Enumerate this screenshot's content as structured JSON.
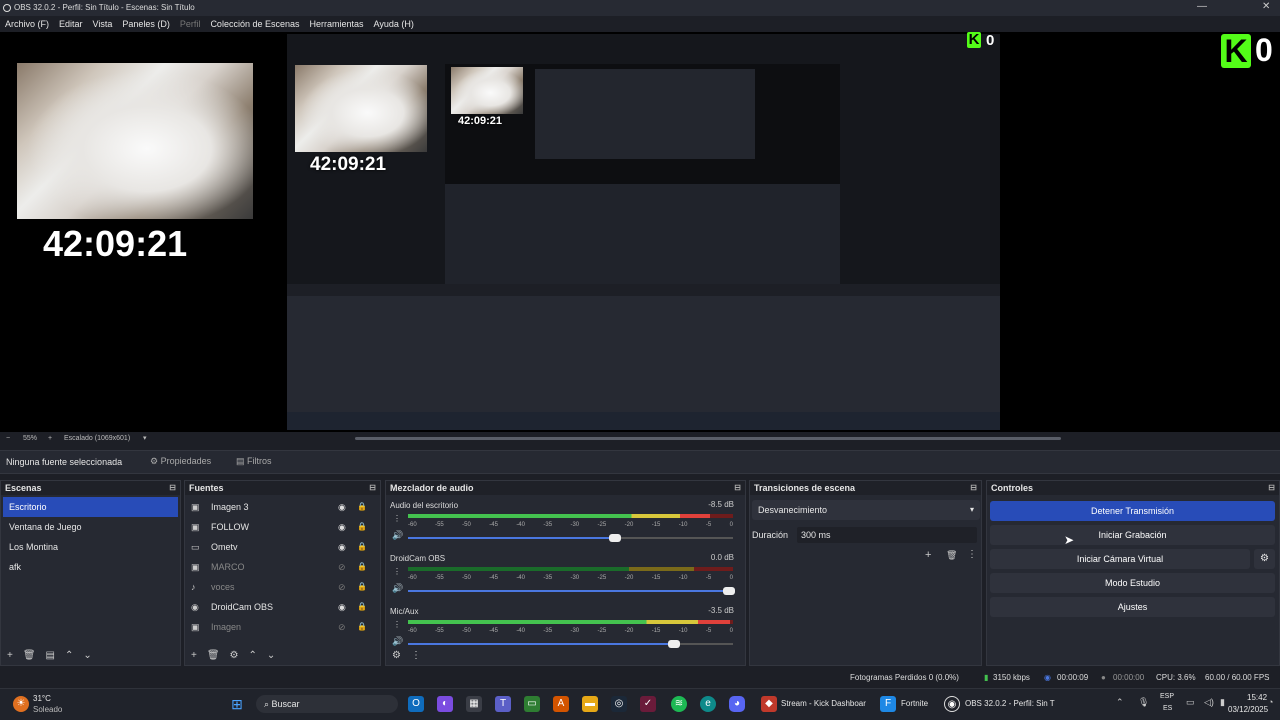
{
  "window": {
    "title": "OBS 32.0.2 - Perfil: Sin Título - Escenas: Sin Título",
    "min": "—",
    "close": "✕"
  },
  "menu": [
    "Archivo (F)",
    "Editar",
    "Vista",
    "Paneles (D)",
    "Perfil",
    "Colección de Escenas",
    "Herramientas",
    "Ayuda (H)"
  ],
  "preview": {
    "clock": "42:09:21",
    "kick_count": "0",
    "kick_logo": "K"
  },
  "zoom": {
    "minus": "−",
    "percent": "55%",
    "plus": "+",
    "scale": "Escalado (1069x601)"
  },
  "sourcebar": {
    "none": "Ninguna fuente seleccionada",
    "properties": "Propiedades",
    "filters": "Filtros"
  },
  "scenes": {
    "title": "Escenas",
    "items": [
      "Escritorio",
      "Ventana de Juego",
      "Los Montina",
      "afk"
    ]
  },
  "sources": {
    "title": "Fuentes",
    "items": [
      {
        "name": "Imagen 3",
        "icon": "image-icon",
        "visible": true,
        "locked": true
      },
      {
        "name": "FOLLOW",
        "icon": "image-icon",
        "visible": true,
        "locked": false
      },
      {
        "name": "Ometv",
        "icon": "window-icon",
        "visible": true,
        "locked": true
      },
      {
        "name": "MARCO",
        "icon": "image-icon",
        "visible": false,
        "locked": true
      },
      {
        "name": "voces",
        "icon": "audio-icon",
        "visible": false,
        "locked": true
      },
      {
        "name": "DroidCam OBS",
        "icon": "video-icon",
        "visible": true,
        "locked": true
      },
      {
        "name": "Imagen",
        "icon": "image-icon",
        "visible": false,
        "locked": true
      }
    ]
  },
  "mixer": {
    "title": "Mezclador de audio",
    "scale": [
      "-60",
      "-55",
      "-50",
      "-45",
      "-40",
      "-35",
      "-30",
      "-25",
      "-20",
      "-15",
      "-10",
      "-5",
      "0"
    ],
    "channels": [
      {
        "name": "Audio del escritorio",
        "db": "-8.5 dB",
        "level": 0.93,
        "volume": 0.65
      },
      {
        "name": "DroidCam OBS",
        "db": "0.0 dB",
        "level": 0.0,
        "volume": 1.0
      },
      {
        "name": "Mic/Aux",
        "db": "-3.5 dB",
        "level": 0.99,
        "volume": 0.83
      }
    ]
  },
  "transitions": {
    "title": "Transiciones de escena",
    "type": "Desvanecimiento",
    "duration_label": "Duración",
    "duration": "300 ms"
  },
  "controls": {
    "title": "Controles",
    "stop_stream": "Detener Transmisión",
    "start_rec": "Iniciar Grabación",
    "virtual_cam": "Iniciar Cámara Virtual",
    "studio": "Modo Estudio",
    "settings": "Ajustes"
  },
  "status": {
    "dropped": "Fotogramas Perdidos 0 (0.0%)",
    "kbps": "3150 kbps",
    "stream_time": "00:00:09",
    "rec_time": "00:00:00",
    "cpu": "CPU: 3.6%",
    "fps": "60.00 / 60.00 FPS"
  },
  "taskbar": {
    "temp": "31°C",
    "weather": "Soleado",
    "search": "Buscar",
    "kick_app": "Stream - Kick Dashboar",
    "fortnite": "Fortnite",
    "obs_app": "OBS 32.0.2 - Perfil: Sin T",
    "lang1": "ESP",
    "lang2": "ES",
    "time": "15:42",
    "date": "03/12/2025"
  },
  "colors": {
    "accent": "#284cb8",
    "kick_green": "#53fc18",
    "bg": "#1d1f26"
  }
}
